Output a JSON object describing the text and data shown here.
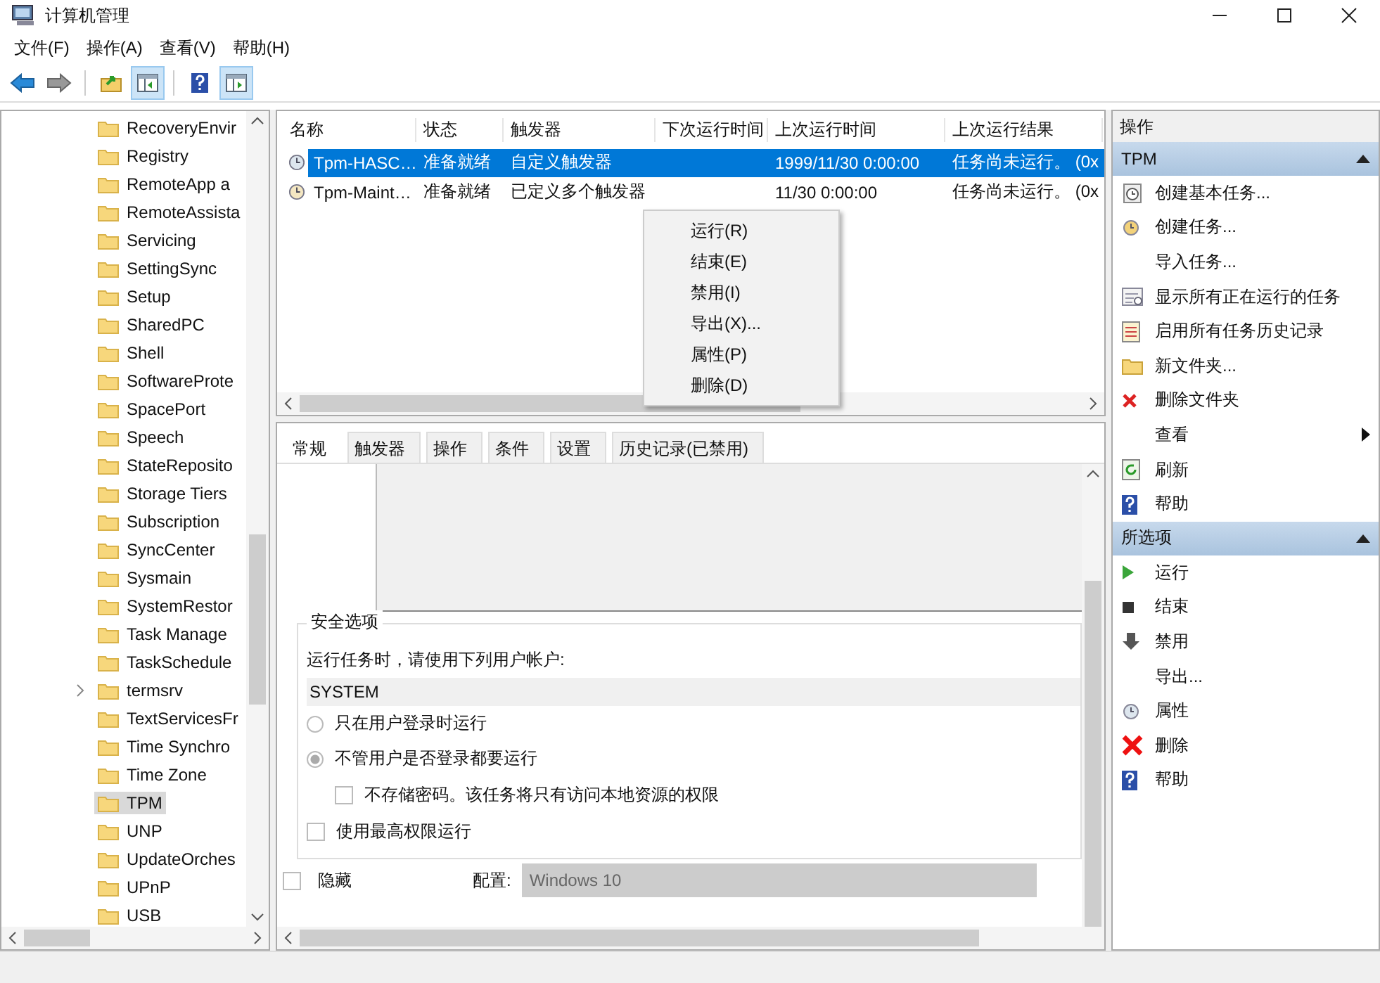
{
  "window": {
    "title": "计算机管理"
  },
  "menu": [
    "文件(F)",
    "操作(A)",
    "查看(V)",
    "帮助(H)"
  ],
  "toolbar": [
    {
      "pressed": false
    },
    {
      "pressed": false
    },
    {
      "pressed": false
    },
    {
      "pressed": true
    },
    {
      "pressed": false
    },
    {
      "pressed": true
    }
  ],
  "tree": {
    "items": [
      {
        "label": "RecoveryEnvir",
        "expandable": false,
        "selected": false
      },
      {
        "label": "Registry",
        "expandable": false,
        "selected": false
      },
      {
        "label": "RemoteApp a",
        "expandable": false,
        "selected": false
      },
      {
        "label": "RemoteAssista",
        "expandable": false,
        "selected": false
      },
      {
        "label": "Servicing",
        "expandable": false,
        "selected": false
      },
      {
        "label": "SettingSync",
        "expandable": false,
        "selected": false
      },
      {
        "label": "Setup",
        "expandable": false,
        "selected": false
      },
      {
        "label": "SharedPC",
        "expandable": false,
        "selected": false
      },
      {
        "label": "Shell",
        "expandable": false,
        "selected": false
      },
      {
        "label": "SoftwareProte",
        "expandable": false,
        "selected": false
      },
      {
        "label": "SpacePort",
        "expandable": false,
        "selected": false
      },
      {
        "label": "Speech",
        "expandable": false,
        "selected": false
      },
      {
        "label": "StateReposito",
        "expandable": false,
        "selected": false
      },
      {
        "label": "Storage Tiers",
        "expandable": false,
        "selected": false
      },
      {
        "label": "Subscription",
        "expandable": false,
        "selected": false
      },
      {
        "label": "SyncCenter",
        "expandable": false,
        "selected": false
      },
      {
        "label": "Sysmain",
        "expandable": false,
        "selected": false
      },
      {
        "label": "SystemRestor",
        "expandable": false,
        "selected": false
      },
      {
        "label": "Task Manage",
        "expandable": false,
        "selected": false
      },
      {
        "label": "TaskSchedule",
        "expandable": false,
        "selected": false
      },
      {
        "label": "termsrv",
        "expandable": true,
        "selected": false
      },
      {
        "label": "TextServicesFr",
        "expandable": false,
        "selected": false
      },
      {
        "label": "Time Synchro",
        "expandable": false,
        "selected": false
      },
      {
        "label": "Time Zone",
        "expandable": false,
        "selected": false
      },
      {
        "label": "TPM",
        "expandable": false,
        "selected": true
      },
      {
        "label": "UNP",
        "expandable": false,
        "selected": false
      },
      {
        "label": "UpdateOrches",
        "expandable": false,
        "selected": false
      },
      {
        "label": "UPnP",
        "expandable": false,
        "selected": false
      },
      {
        "label": "USB",
        "expandable": false,
        "selected": false
      }
    ]
  },
  "table": {
    "columns": [
      "名称",
      "状态",
      "触发器",
      "下次运行时间",
      "上次运行时间",
      "上次运行结果"
    ],
    "rows": [
      {
        "name": "Tpm-HASC…",
        "status": "准备就绪",
        "trigger": "自定义触发器",
        "last_run": "1999/11/30 0:00:00",
        "last_result": "任务尚未运行。 (0x",
        "selected": true
      },
      {
        "name": "Tpm-Maint…",
        "status": "准备就绪",
        "trigger": "已定义多个触发器",
        "last_run": "11/30 0:00:00",
        "last_result": "任务尚未运行。 (0x",
        "selected": false
      }
    ]
  },
  "context_menu": [
    "运行(R)",
    "结束(E)",
    "禁用(I)",
    "导出(X)...",
    "属性(P)",
    "删除(D)"
  ],
  "details": {
    "tabs": [
      {
        "label": "常规",
        "selected": true
      },
      {
        "label": "触发器",
        "selected": false
      },
      {
        "label": "操作",
        "selected": false
      },
      {
        "label": "条件",
        "selected": false
      },
      {
        "label": "设置",
        "selected": false
      },
      {
        "label": "历史记录(已禁用)",
        "selected": false
      }
    ],
    "security": {
      "title": "安全选项",
      "account_label": "运行任务时，请使用下列用户帐户:",
      "account": "SYSTEM",
      "radios": [
        {
          "label": "只在用户登录时运行",
          "selected": false
        },
        {
          "label": "不管用户是否登录都要运行",
          "selected": true
        }
      ],
      "no_password": {
        "label": "不存储密码。该任务将只有访问本地资源的权限",
        "checked": false
      },
      "highest": {
        "label": "使用最高权限运行",
        "checked": false
      }
    },
    "hidden": {
      "label": "隐藏",
      "checked": false
    },
    "config": {
      "label": "配置:",
      "value": "Windows 10",
      "disabled": true
    }
  },
  "actions": {
    "title": "操作",
    "sections": [
      {
        "title": "TPM",
        "expanded": true,
        "items": [
          {
            "label": "创建基本任务...",
            "submenu": false
          },
          {
            "label": "创建任务...",
            "submenu": false
          },
          {
            "label": "导入任务...",
            "submenu": false
          },
          {
            "label": "显示所有正在运行的任务",
            "submenu": false
          },
          {
            "label": "启用所有任务历史记录",
            "submenu": false
          },
          {
            "label": "新文件夹...",
            "submenu": false
          },
          {
            "label": "删除文件夹",
            "submenu": false
          },
          {
            "label": "查看",
            "submenu": true
          },
          {
            "label": "刷新",
            "submenu": false
          },
          {
            "label": "帮助",
            "submenu": false
          }
        ]
      },
      {
        "title": "所选项",
        "expanded": true,
        "items": [
          {
            "label": "运行",
            "submenu": false
          },
          {
            "label": "结束",
            "submenu": false
          },
          {
            "label": "禁用",
            "submenu": false
          },
          {
            "label": "导出...",
            "submenu": false
          },
          {
            "label": "属性",
            "submenu": false
          },
          {
            "label": "删除",
            "submenu": false
          },
          {
            "label": "帮助",
            "submenu": false
          }
        ]
      }
    ]
  }
}
